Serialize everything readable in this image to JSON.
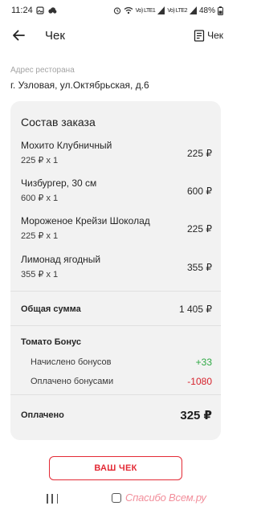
{
  "status_bar": {
    "time": "11:24",
    "network_1": "Vo) LTE1",
    "network_2": "Vo) LTE2",
    "battery": "48%"
  },
  "header": {
    "title": "Чек",
    "receipt_button_label": "Чек"
  },
  "restaurant": {
    "address_label": "Адрес ресторана",
    "address": "г. Узловая, ул.Октябрьская, д.6"
  },
  "order": {
    "title": "Состав заказа",
    "items": [
      {
        "name": "Мохито Клубничный",
        "qty": "225 ₽ x 1",
        "price": "225 ₽"
      },
      {
        "name": "Чизбургер, 30 см",
        "qty": "600 ₽ x 1",
        "price": "600 ₽"
      },
      {
        "name": "Мороженое Крейзи Шоколад",
        "qty": "225 ₽ x 1",
        "price": "225 ₽"
      },
      {
        "name": "Лимонад ягодный",
        "qty": "355 ₽ x 1",
        "price": "355 ₽"
      }
    ],
    "total_label": "Общая сумма",
    "total_value": "1 405 ₽",
    "bonus_title": "Томато Бонус",
    "bonus_accrued_label": "Начислено бонусов",
    "bonus_accrued_value": "+33",
    "bonus_paid_label": "Оплачено бонусами",
    "bonus_paid_value": "-1080",
    "paid_label": "Оплачено",
    "paid_value": "325 ₽"
  },
  "actions": {
    "your_receipt_label": "ВАШ ЧЕК"
  },
  "watermark": {
    "text": "Спасибо Всем.ру"
  },
  "colors": {
    "accent_red": "#e32a35",
    "bonus_green": "#2ea944",
    "bonus_red": "#d6212b",
    "card_bg": "#f2f2f2"
  },
  "icons": [
    "back-arrow-icon",
    "receipt-icon",
    "wifi-icon",
    "battery-icon",
    "gallery-icon",
    "cloud-icon"
  ]
}
